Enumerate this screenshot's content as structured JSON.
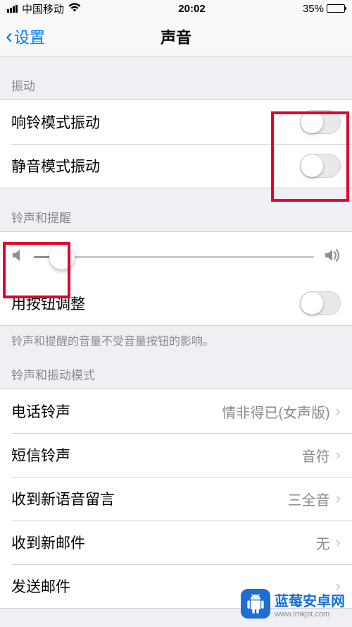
{
  "status": {
    "carrier": "中国移动",
    "time": "20:02",
    "battery_pct": "35%"
  },
  "nav": {
    "back_label": "设置",
    "title": "声音"
  },
  "sections": {
    "vibration_header": "振动",
    "vibrate_on_ring": "响铃模式振动",
    "vibrate_on_silent": "静音模式振动",
    "ringer_header": "铃声和提醒",
    "change_with_buttons": "用按钮调整",
    "ringer_footer": "铃声和提醒的音量不受音量按钮的影响。",
    "patterns_header": "铃声和振动模式"
  },
  "rows": {
    "ringtone": {
      "label": "电话铃声",
      "value": "情非得已(女声版)"
    },
    "text_tone": {
      "label": "短信铃声",
      "value": "音符"
    },
    "new_voicemail": {
      "label": "收到新语音留言",
      "value": "三全音"
    },
    "new_mail": {
      "label": "收到新邮件",
      "value": "无"
    },
    "sent_mail": {
      "label": "发送邮件",
      "value": ""
    }
  },
  "slider": {
    "value_pct": 10
  },
  "watermark": {
    "title": "蓝莓安卓网",
    "url": "www.lmkjst.com"
  }
}
